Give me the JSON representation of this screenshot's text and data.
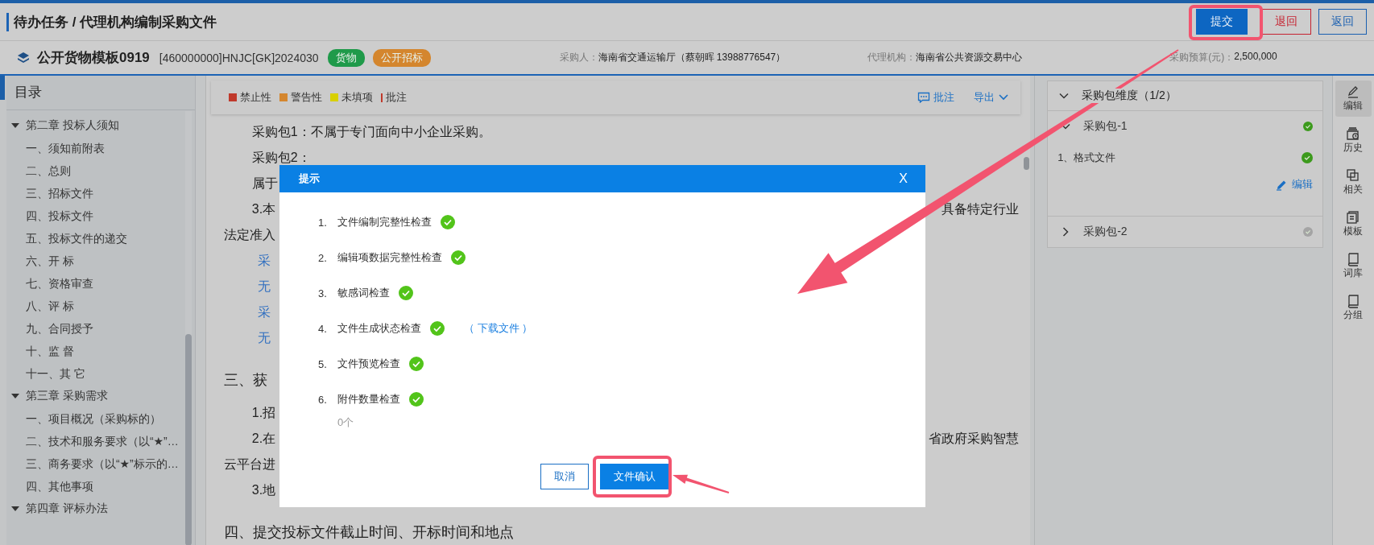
{
  "breadcrumb": "待办任务 / 代理机构编制采购文件",
  "header_buttons": [
    {
      "label": "提交",
      "kind": "primary"
    },
    {
      "label": "退回",
      "kind": "danger"
    },
    {
      "label": "返回",
      "kind": "default"
    }
  ],
  "project": {
    "name": "公开货物模板0919",
    "code": "[460000000]HNJC[GK]2024030",
    "tags": [
      {
        "label": "货物",
        "color": "#1f9a4a"
      },
      {
        "label": "公开招标",
        "color": "#d4862e"
      }
    ],
    "fields": [
      {
        "label": "采购人：",
        "value": "海南省交通运输厅（蔡朝晖 13988776547）"
      },
      {
        "label": "代理机构：",
        "value": "海南省公共资源交易中心"
      },
      {
        "label": "采购预算(元)：",
        "value": "2,500,000"
      }
    ]
  },
  "toc": {
    "title": "目录",
    "items": [
      {
        "label": "第二章 投标人须知",
        "expanded": true,
        "children": [
          {
            "label": "一、须知前附表"
          },
          {
            "label": "二、总则"
          },
          {
            "label": "三、招标文件"
          },
          {
            "label": "四、投标文件"
          },
          {
            "label": "五、投标文件的递交"
          },
          {
            "label": "六、开 标"
          },
          {
            "label": "七、资格审查"
          },
          {
            "label": "八、评 标"
          },
          {
            "label": "九、合同授予"
          },
          {
            "label": "十、监 督"
          },
          {
            "label": "十一、其 它"
          }
        ]
      },
      {
        "label": "第三章 采购需求",
        "expanded": true,
        "children": [
          {
            "label": "一、项目概况（采购标的）"
          },
          {
            "label": "二、技术和服务要求（以“★”…"
          },
          {
            "label": "三、商务要求（以“★”标示的…"
          },
          {
            "label": "四、其他事项"
          }
        ]
      },
      {
        "label": "第四章 评标办法",
        "expanded": true
      }
    ]
  },
  "legend": [
    {
      "label": "禁止性",
      "color": "#c0392b",
      "kind": "square"
    },
    {
      "label": "警告性",
      "color": "#d4862e",
      "kind": "square"
    },
    {
      "label": "未填项",
      "color": "#d8d000",
      "kind": "square"
    },
    {
      "label": "批注",
      "color": "#c0392b",
      "kind": "bar"
    }
  ],
  "doc_toolbar": [
    {
      "label": "批注",
      "kind": "comment"
    },
    {
      "label": "导出",
      "kind": "dropdown"
    }
  ],
  "document_lines": [
    {
      "kind": "para",
      "left": "采购包1：不属于专门面向中小企业采购。"
    },
    {
      "kind": "para",
      "left": "采购包2："
    },
    {
      "kind": "para",
      "left": "属于"
    },
    {
      "kind": "para",
      "left": "3.本",
      "right": "具备特定行业"
    },
    {
      "kind": "cont",
      "left": "法定准入"
    },
    {
      "kind": "link",
      "left": "采"
    },
    {
      "kind": "link",
      "left": "无"
    },
    {
      "kind": "link",
      "left": "采"
    },
    {
      "kind": "link",
      "left": "无"
    },
    {
      "kind": "heading",
      "left": "三、获"
    },
    {
      "kind": "para",
      "left": "1.招"
    },
    {
      "kind": "para",
      "left": "2.在",
      "right": "省政府采购智慧"
    },
    {
      "kind": "cont",
      "left": "云平台进"
    },
    {
      "kind": "para",
      "left": "3.地"
    },
    {
      "kind": "heading",
      "left": "四、提交投标文件截止时间、开标时间和地点"
    }
  ],
  "dialog": {
    "title": "提示",
    "close": "X",
    "checks": [
      {
        "number": "1.",
        "label": "文件编制完整性检查",
        "passed": true
      },
      {
        "number": "2.",
        "label": "编辑项数据完整性检查",
        "passed": true
      },
      {
        "number": "3.",
        "label": "敏感词检查",
        "passed": true
      },
      {
        "number": "4.",
        "label": "文件生成状态检查",
        "passed": true,
        "link": "（ 下载文件 ）"
      },
      {
        "number": "5.",
        "label": "文件预览检查",
        "passed": true
      },
      {
        "number": "6.",
        "label": "附件数量检查",
        "passed": true,
        "note": "0个"
      }
    ],
    "buttons": [
      {
        "label": "取消",
        "kind": "default"
      },
      {
        "label": "文件确认",
        "kind": "primary"
      }
    ]
  },
  "package_panel": {
    "title": "采购包维度（1/2）",
    "expanded": true,
    "packages": [
      {
        "name": "采购包-1",
        "expanded": true,
        "done": true,
        "files": [
          {
            "label": "1、格式文件",
            "done": true
          }
        ],
        "action": "编辑"
      },
      {
        "name": "采购包-2",
        "expanded": false,
        "done": false
      }
    ]
  },
  "tool_rail": [
    {
      "label": "编辑",
      "kind": "edit",
      "selected": true
    },
    {
      "label": "历史",
      "kind": "history",
      "selected": false
    },
    {
      "label": "相关",
      "kind": "related",
      "selected": false
    },
    {
      "label": "模板",
      "kind": "template",
      "selected": false
    },
    {
      "label": "词库",
      "kind": "glossary",
      "selected": false
    },
    {
      "label": "分组",
      "kind": "group",
      "selected": false
    }
  ]
}
